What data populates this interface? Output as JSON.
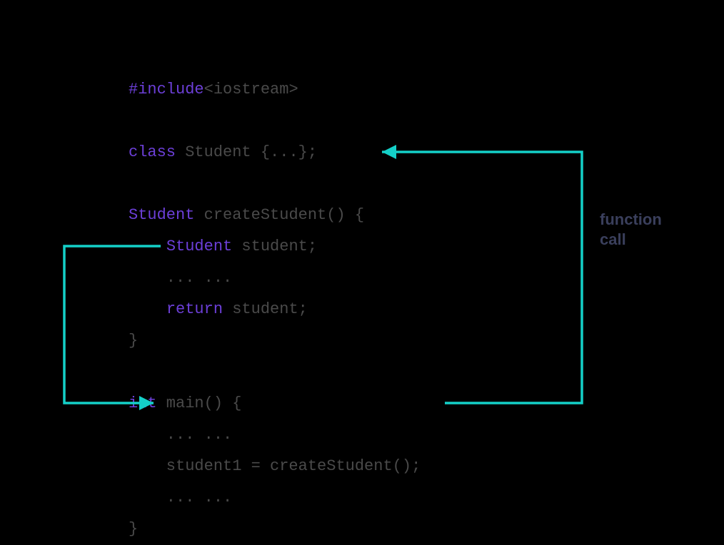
{
  "code": {
    "line1_keyword": "#include",
    "line1_rest": "<iostream>",
    "line2_keyword": "class",
    "line2_rest": " Student {...};",
    "line3_type": "Student",
    "line3_rest": " createStudent() {",
    "line4_indent": "    ",
    "line4_type": "Student",
    "line4_rest": " student;",
    "line5": "    ... ...",
    "line6_indent": "    ",
    "line6_keyword": "return",
    "line6_rest": " student;",
    "line7": "}",
    "line8_type": "int",
    "line8_rest": " main() {",
    "line9": "    ... ...",
    "line10": "    student1 = createStudent();",
    "line11": "    ... ...",
    "line12": "}"
  },
  "annotation": {
    "line1": "function",
    "line2": "call"
  },
  "colors": {
    "accent": "#14d0c8",
    "keyword": "#6c3fd8",
    "plain": "#4a4a4a",
    "annotation": "#3a3f5c"
  }
}
